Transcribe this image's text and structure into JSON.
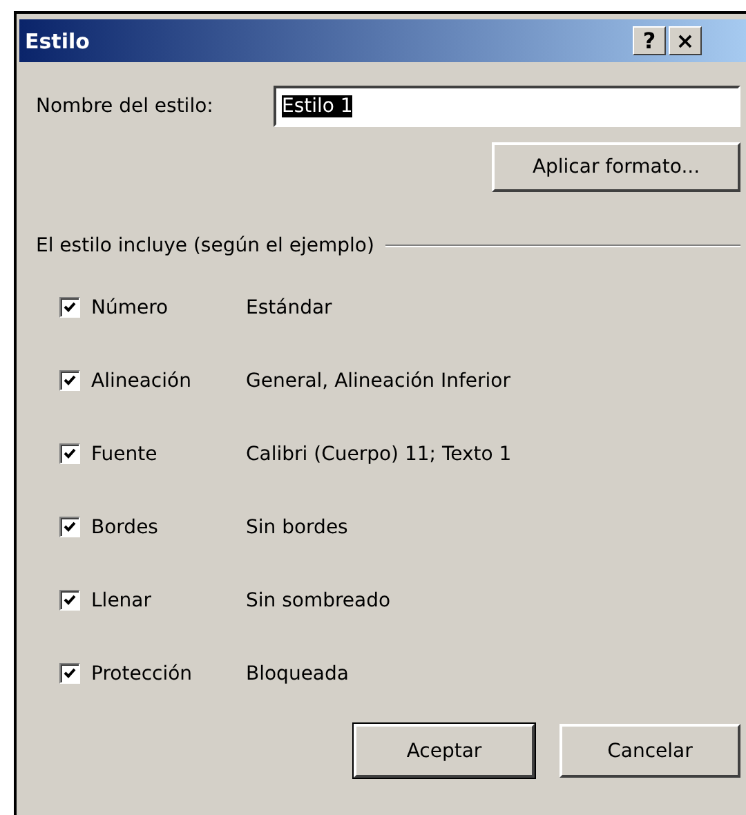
{
  "window": {
    "title": "Estilo",
    "title_buttons": [
      "?",
      "×"
    ]
  },
  "style_name": {
    "label": "Nombre del estilo:",
    "value": "Estilo 1",
    "value_selected": true
  },
  "format_button": "Aplicar formato...",
  "group": {
    "title": "El estilo incluye (según el ejemplo)",
    "items": [
      {
        "label": "Número",
        "value": "Estándar",
        "checked": true
      },
      {
        "label": "Alineación",
        "value": "General, Alineación Inferior",
        "checked": true
      },
      {
        "label": "Fuente",
        "value": "Calibri (Cuerpo) 11; Texto 1",
        "checked": true
      },
      {
        "label": "Bordes",
        "value": "Sin bordes",
        "checked": true
      },
      {
        "label": "Llenar",
        "value": "Sin sombreado",
        "checked": true
      },
      {
        "label": "Protección",
        "value": "Bloqueada",
        "checked": true
      }
    ]
  },
  "buttons": [
    {
      "label": "Aceptar",
      "default": true
    },
    {
      "label": "Cancelar",
      "default": false
    }
  ]
}
